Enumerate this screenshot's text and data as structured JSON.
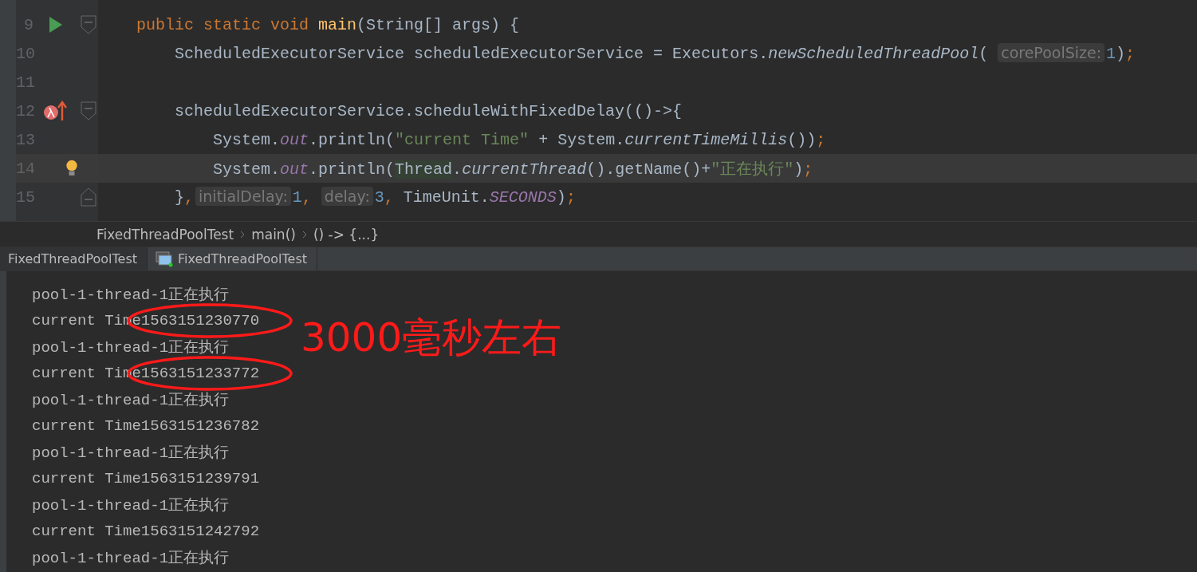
{
  "editor": {
    "lines": [
      {
        "number": "9",
        "marker": {
          "kind": "run"
        },
        "fold": {
          "kind": "start"
        },
        "highlighted": false,
        "tokens": [
          {
            "kind": "keyword",
            "text": "    public static void "
          },
          {
            "kind": "function",
            "text": "main"
          },
          {
            "kind": "plain",
            "text": "(String[] args) {"
          }
        ]
      },
      {
        "number": "10",
        "highlighted": false,
        "tokens": [
          {
            "kind": "plain",
            "text": "        ScheduledExecutorService scheduledExecutorService = Executors."
          },
          {
            "kind": "italic",
            "text": "newScheduledThreadPool"
          },
          {
            "kind": "plain",
            "text": "("
          },
          {
            "kind": "hint",
            "text": "corePoolSize:"
          },
          {
            "kind": "number",
            "text": "1"
          },
          {
            "kind": "plain",
            "text": ")"
          },
          {
            "kind": "keyword",
            "text": ";"
          }
        ]
      },
      {
        "number": "11",
        "highlighted": false
      },
      {
        "number": "12",
        "marker": {
          "kind": "lambda"
        },
        "fold": {
          "kind": "start"
        },
        "highlighted": false,
        "tokens": [
          {
            "kind": "plain",
            "text": "        scheduledExecutorService.scheduleWithFixedDelay(()->{"
          }
        ]
      },
      {
        "number": "13",
        "highlighted": false,
        "tokens": [
          {
            "kind": "plain",
            "text": "            System."
          },
          {
            "kind": "field",
            "text": "out"
          },
          {
            "kind": "plain",
            "text": ".println("
          },
          {
            "kind": "string",
            "text": "\"current Time\""
          },
          {
            "kind": "plain",
            "text": " + System."
          },
          {
            "kind": "italic",
            "text": "currentTimeMillis"
          },
          {
            "kind": "plain",
            "text": "())"
          },
          {
            "kind": "keyword",
            "text": ";"
          }
        ]
      },
      {
        "number": "14",
        "marker": {
          "kind": "bulb"
        },
        "highlighted": true,
        "tokens": [
          {
            "kind": "plain",
            "text": "            System."
          },
          {
            "kind": "field",
            "text": "out"
          },
          {
            "kind": "plain",
            "text": ".println("
          },
          {
            "kind": "usage",
            "text": "Thread"
          },
          {
            "kind": "plain",
            "text": "."
          },
          {
            "kind": "italic",
            "text": "currentThread"
          },
          {
            "kind": "plain",
            "text": "().getName()+"
          },
          {
            "kind": "string",
            "text": "\"正在执行\""
          },
          {
            "kind": "plain",
            "text": ")"
          },
          {
            "kind": "keyword",
            "text": ";"
          }
        ]
      },
      {
        "number": "15",
        "fold": {
          "kind": "end"
        },
        "highlighted": false,
        "tokens": [
          {
            "kind": "plain",
            "text": "        }"
          },
          {
            "kind": "keyword",
            "text": ","
          },
          {
            "kind": "hint",
            "text": "initialDelay:"
          },
          {
            "kind": "number",
            "text": "1"
          },
          {
            "kind": "keyword",
            "text": ","
          },
          {
            "kind": "hint",
            "text": "delay:"
          },
          {
            "kind": "number",
            "text": "3"
          },
          {
            "kind": "keyword",
            "text": ","
          },
          {
            "kind": "plain",
            "text": " TimeUnit."
          },
          {
            "kind": "field",
            "text": "SECONDS"
          },
          {
            "kind": "plain",
            "text": ")"
          },
          {
            "kind": "keyword",
            "text": ";"
          }
        ]
      }
    ]
  },
  "breadcrumb": [
    "FixedThreadPoolTest",
    "main()",
    "() -> {...}"
  ],
  "tabs": [
    {
      "label": "FixedThreadPoolTest",
      "selected": true
    },
    {
      "label": "FixedThreadPoolTest",
      "selected": false
    }
  ],
  "console": {
    "lines": [
      {
        "text": "pool-1-thread-1正在执行",
        "circled": false
      },
      {
        "text": "current Time1563151230770",
        "circled": true
      },
      {
        "text": "pool-1-thread-1正在执行",
        "circled": false
      },
      {
        "text": "current Time1563151233772",
        "circled": true
      },
      {
        "text": "pool-1-thread-1正在执行",
        "circled": false
      },
      {
        "text": "current Time1563151236782",
        "circled": false
      },
      {
        "text": "pool-1-thread-1正在执行",
        "circled": false
      },
      {
        "text": "current Time1563151239791",
        "circled": false
      },
      {
        "text": "pool-1-thread-1正在执行",
        "circled": false
      },
      {
        "text": "current Time1563151242792",
        "circled": false
      },
      {
        "text": "pool-1-thread-1正在执行",
        "circled": false
      }
    ]
  },
  "annotation": {
    "note": "3000毫秒左右"
  }
}
